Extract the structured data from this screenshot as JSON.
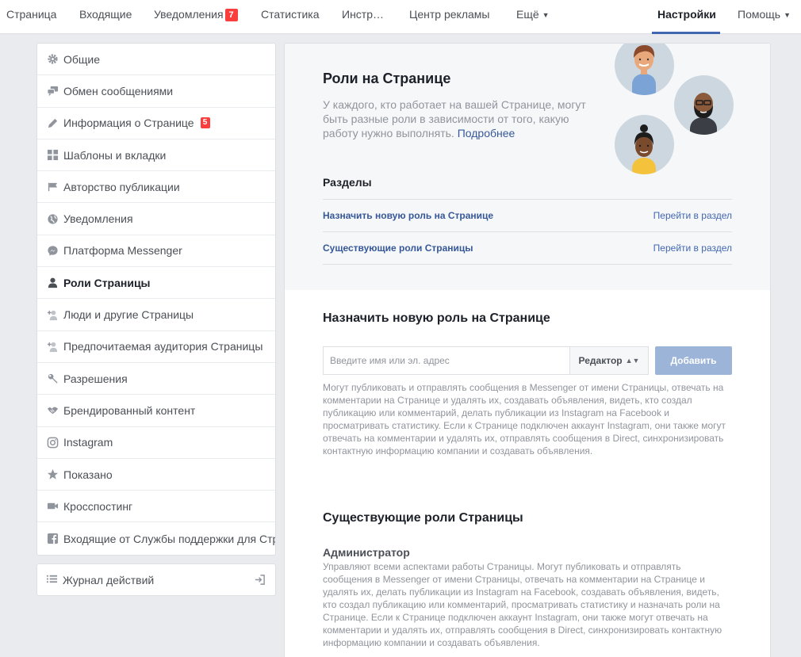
{
  "topnav": {
    "items": [
      {
        "label": "Страница"
      },
      {
        "label": "Входящие"
      },
      {
        "label": "Уведомления",
        "badge": "7"
      },
      {
        "label": "Статистика"
      },
      {
        "label": "Инстр…"
      },
      {
        "label": "Центр рекламы"
      },
      {
        "label": "Ещё"
      },
      {
        "label": "Настройки"
      },
      {
        "label": "Помощь"
      }
    ],
    "accent": "#4267b2"
  },
  "sidebar": {
    "items": [
      {
        "label": "Общие",
        "icon": "gear-icon"
      },
      {
        "label": "Обмен сообщениями",
        "icon": "chat-icon"
      },
      {
        "label": "Информация о Странице",
        "icon": "pencil-icon",
        "badge": "5"
      },
      {
        "label": "Шаблоны и вкладки",
        "icon": "grid-icon"
      },
      {
        "label": "Авторство публикации",
        "icon": "flag-icon"
      },
      {
        "label": "Уведомления",
        "icon": "globe-icon"
      },
      {
        "label": "Платформа Messenger",
        "icon": "messenger-icon"
      },
      {
        "label": "Роли Страницы",
        "icon": "person-icon"
      },
      {
        "label": "Люди и другие Страницы",
        "icon": "person-add-icon"
      },
      {
        "label": "Предпочитаемая аудитория Страницы",
        "icon": "audience-icon"
      },
      {
        "label": "Разрешения",
        "icon": "wrench-icon"
      },
      {
        "label": "Брендированный контент",
        "icon": "handshake-icon"
      },
      {
        "label": "Instagram",
        "icon": "instagram-icon"
      },
      {
        "label": "Показано",
        "icon": "star-icon"
      },
      {
        "label": "Кросспостинг",
        "icon": "video-icon"
      },
      {
        "label": "Входящие от Службы поддержки для Стр",
        "icon": "facebook-icon"
      }
    ],
    "journal": {
      "label": "Журнал действий",
      "icon": "list-icon"
    }
  },
  "hero": {
    "title": "Роли на Странице",
    "description": "У каждого, кто работает на вашей Странице, могут быть разные роли в зависимости от того, какую работу нужно выполнять.",
    "more_link": "Подробнее",
    "sections_title": "Разделы",
    "sections": [
      {
        "label": "Назначить новую роль на Странице",
        "action": "Перейти в раздел"
      },
      {
        "label": "Существующие роли Страницы",
        "action": "Перейти в раздел"
      }
    ]
  },
  "assign": {
    "title": "Назначить новую роль на Странице",
    "input_placeholder": "Введите имя или эл. адрес",
    "input_value": "",
    "role_value": "Редактор",
    "add_label": "Добавить",
    "description": "Могут публиковать и отправлять сообщения в Messenger от имени Страницы, отвечать на комментарии на Странице и удалять их, создавать объявления, видеть, кто создал публикацию или комментарий, делать публикации из Instagram на Facebook и просматривать статистику. Если к Странице подключен аккаунт Instagram, они также могут отвечать на комментарии и удалять их, отправлять сообщения в Direct, синхронизировать контактную информацию компании и создавать объявления."
  },
  "existing": {
    "title": "Существующие роли Страницы",
    "role_name": "Администратор",
    "role_description": "Управляют всеми аспектами работы Страницы. Могут публиковать и отправлять сообщения в Messenger от имени Страницы, отвечать на комментарии на Странице и удалять их, делать публикации из Instagram на Facebook, создавать объявления, видеть, кто создал публикацию или комментарий, просматривать статистику и назначать роли на Странице. Если к Странице подключен аккаунт Instagram, они также могут отвечать на комментарии и удалять их, отправлять сообщения в Direct, синхронизировать контактную информацию компании и создавать объявления."
  }
}
